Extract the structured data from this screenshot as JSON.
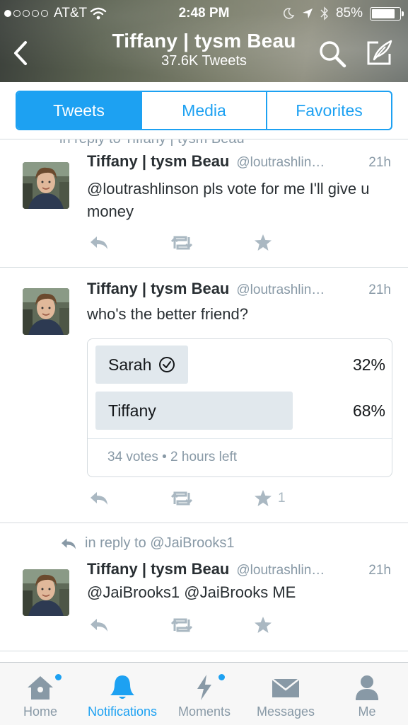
{
  "status_bar": {
    "carrier": "AT&T",
    "time": "2:48 PM",
    "battery": "85%",
    "battery_level": 0.85,
    "signal_bars_filled": 1,
    "signal_bars_total": 5
  },
  "header": {
    "title": "Tiffany | tysm Beau",
    "subtitle": "37.6K Tweets"
  },
  "tabs": [
    {
      "label": "Tweets",
      "active": true
    },
    {
      "label": "Media",
      "active": false
    },
    {
      "label": "Favorites",
      "active": false
    }
  ],
  "feed": {
    "cut_reply_text": "in reply to Tiffany | tysm Beau",
    "tweets": [
      {
        "name": "Tiffany | tysm Beau",
        "handle": "@loutrashlin…",
        "time": "21h",
        "text": "@loutrashlinson pls vote for me I'll give u money",
        "favorites": ""
      },
      {
        "name": "Tiffany | tysm Beau",
        "handle": "@loutrashlin…",
        "time": "21h",
        "text": "who's the better friend?",
        "favorites": "1",
        "poll": {
          "options": [
            {
              "label": "Sarah",
              "percent": "32%",
              "value": 32,
              "voted": true
            },
            {
              "label": "Tiffany",
              "percent": "68%",
              "value": 68,
              "voted": false
            }
          ],
          "footer": "34 votes • 2 hours left"
        }
      },
      {
        "reply_context": "in reply to @JaiBrooks1",
        "name": "Tiffany | tysm Beau",
        "handle": "@loutrashlin…",
        "time": "21h",
        "text": "@JaiBrooks1 @JaiBrooks ME",
        "favorites": ""
      }
    ]
  },
  "tabbar": [
    {
      "label": "Home",
      "icon": "home-icon",
      "active": false,
      "badge": true
    },
    {
      "label": "Notifications",
      "icon": "bell-icon",
      "active": true,
      "badge": false
    },
    {
      "label": "Moments",
      "icon": "lightning-icon",
      "active": false,
      "badge": true
    },
    {
      "label": "Messages",
      "icon": "envelope-icon",
      "active": false,
      "badge": false
    },
    {
      "label": "Me",
      "icon": "person-icon",
      "active": false,
      "badge": false
    }
  ],
  "colors": {
    "accent": "#1da1f2",
    "muted": "#8899a6",
    "action_icon": "#aab8c2",
    "poll_bar": "#e1e8ed"
  }
}
